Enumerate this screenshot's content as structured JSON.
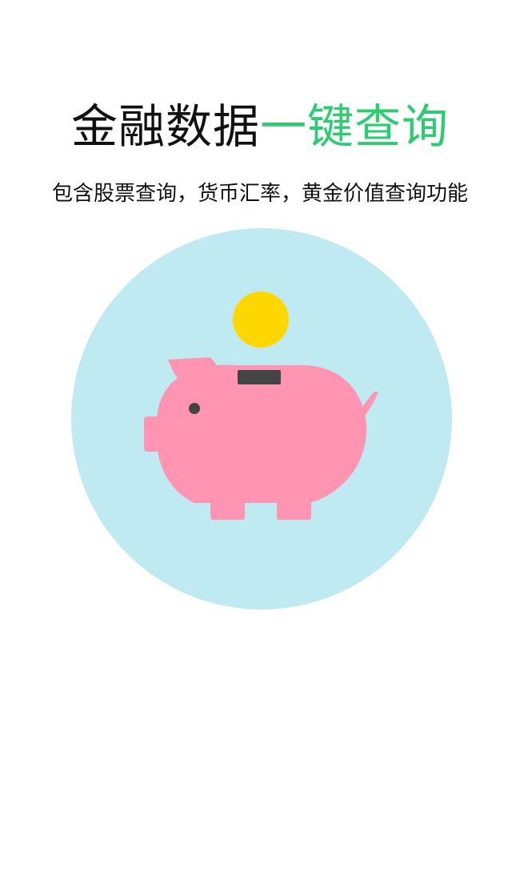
{
  "splash": {
    "title_part1": "金融数据",
    "title_part2": "一键查询",
    "subtitle": "包含股票查询，货币汇率，黄金价值查询功能"
  },
  "illustration": {
    "icon": "piggy-bank-icon",
    "coin_icon": "coin-icon"
  },
  "colors": {
    "title_dark": "#111111",
    "title_accent": "#2ecc71",
    "circle_bg": "#c0eaf2",
    "pig": "#ff94b3",
    "coin": "#ffd700",
    "slot": "#444444"
  }
}
